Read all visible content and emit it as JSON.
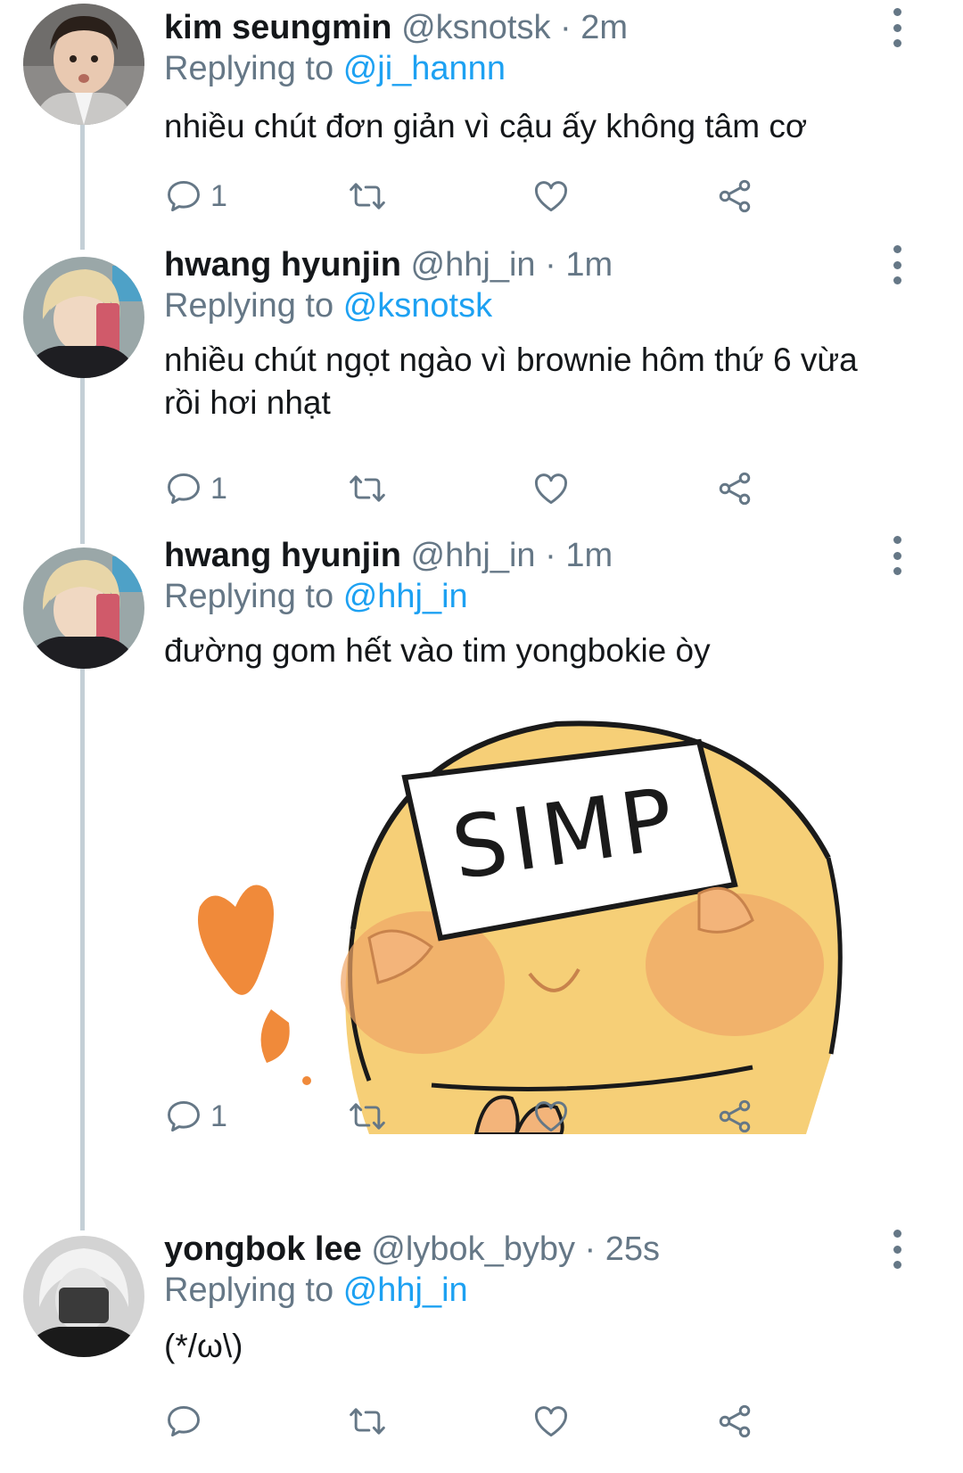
{
  "tweets": [
    {
      "name": "kim seungmin",
      "handle": "@ksnotsk",
      "separator": "·",
      "time": "2m",
      "replying_label": "Replying to",
      "replying_to": "@ji_hannn",
      "text": "nhiều chút đơn giản vì cậu ấy không tâm cơ",
      "reply_count": "1"
    },
    {
      "name": "hwang hyunjin",
      "handle": "@hhj_in",
      "separator": "·",
      "time": "1m",
      "replying_label": "Replying to",
      "replying_to": "@ksnotsk",
      "text": "nhiều chút ngọt ngào vì brownie hôm thứ 6 vừa rồi hơi nhạt",
      "reply_count": "1"
    },
    {
      "name": "hwang hyunjin",
      "handle": "@hhj_in",
      "separator": "·",
      "time": "1m",
      "replying_label": "Replying to",
      "replying_to": "@hhj_in",
      "text": "đường gom hết vào tim yongbokie òy",
      "media_caption": "SIMP",
      "reply_count": "1"
    },
    {
      "name": "yongbok lee",
      "handle": "@lybok_byby",
      "separator": "·",
      "time": "25s",
      "replying_label": "Replying to",
      "replying_to": "@hhj_in",
      "text": "(*/ω\\)",
      "reply_count": ""
    }
  ],
  "icons": {
    "reply": "reply-icon",
    "retweet": "retweet-icon",
    "like": "like-icon",
    "share": "share-icon",
    "more": "more-vertical-icon"
  },
  "colors": {
    "accent": "#1da1f2",
    "muted": "#657786",
    "thread_line": "#c4cfd6"
  }
}
